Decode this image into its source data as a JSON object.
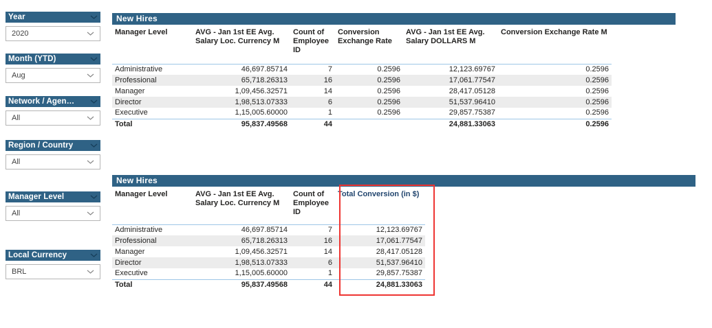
{
  "theme": {
    "header_bar_color": "#2f6285",
    "separator_line_color": "#9dc6e6",
    "alt_row_color": "#ececec",
    "highlight_box_color": "#ee3431",
    "highlighted_header_color": "#21456e"
  },
  "slicers": [
    {
      "label": "Year",
      "value": "2020"
    },
    {
      "label": "Month (YTD)",
      "value": "Aug"
    },
    {
      "label": "Network / Agen…",
      "value": "All"
    },
    {
      "label": "Region / Country",
      "value": "All"
    },
    {
      "label": "Manager Level",
      "value": "All"
    },
    {
      "label": "Local Currency",
      "value": "BRL"
    }
  ],
  "tables": [
    {
      "title": "New Hires",
      "columns": [
        "Manager Level",
        "AVG - Jan 1st EE Avg. Salary Loc. Currency M",
        "Count of Employee ID",
        "Conversion Exchange Rate",
        "AVG - Jan 1st EE Avg. Salary DOLLARS M",
        "Conversion Exchange Rate M"
      ],
      "rows": [
        [
          "Administrative",
          "46,697.85714",
          "7",
          "0.2596",
          "12,123.69767",
          "0.2596"
        ],
        [
          "Professional",
          "65,718.26313",
          "16",
          "0.2596",
          "17,061.77547",
          "0.2596"
        ],
        [
          "Manager",
          "1,09,456.32571",
          "14",
          "0.2596",
          "28,417.05128",
          "0.2596"
        ],
        [
          "Director",
          "1,98,513.07333",
          "6",
          "0.2596",
          "51,537.96410",
          "0.2596"
        ],
        [
          "Executive",
          "1,15,005.60000",
          "1",
          "0.2596",
          "29,857.75387",
          "0.2596"
        ],
        [
          "Total",
          "95,837.49568",
          "44",
          "",
          "24,881.33063",
          "0.2596"
        ]
      ]
    },
    {
      "title": "New Hires",
      "columns": [
        "Manager Level",
        "AVG - Jan 1st EE Avg. Salary Loc. Currency M",
        "Count of Employee ID",
        "Total Conversion (in $)"
      ],
      "highlighted_column": "Total Conversion (in $)",
      "rows": [
        [
          "Administrative",
          "46,697.85714",
          "7",
          "12,123.69767"
        ],
        [
          "Professional",
          "65,718.26313",
          "16",
          "17,061.77547"
        ],
        [
          "Manager",
          "1,09,456.32571",
          "14",
          "28,417.05128"
        ],
        [
          "Director",
          "1,98,513.07333",
          "6",
          "51,537.96410"
        ],
        [
          "Executive",
          "1,15,005.60000",
          "1",
          "29,857.75387"
        ],
        [
          "Total",
          "95,837.49568",
          "44",
          "24,881.33063"
        ]
      ]
    }
  ]
}
